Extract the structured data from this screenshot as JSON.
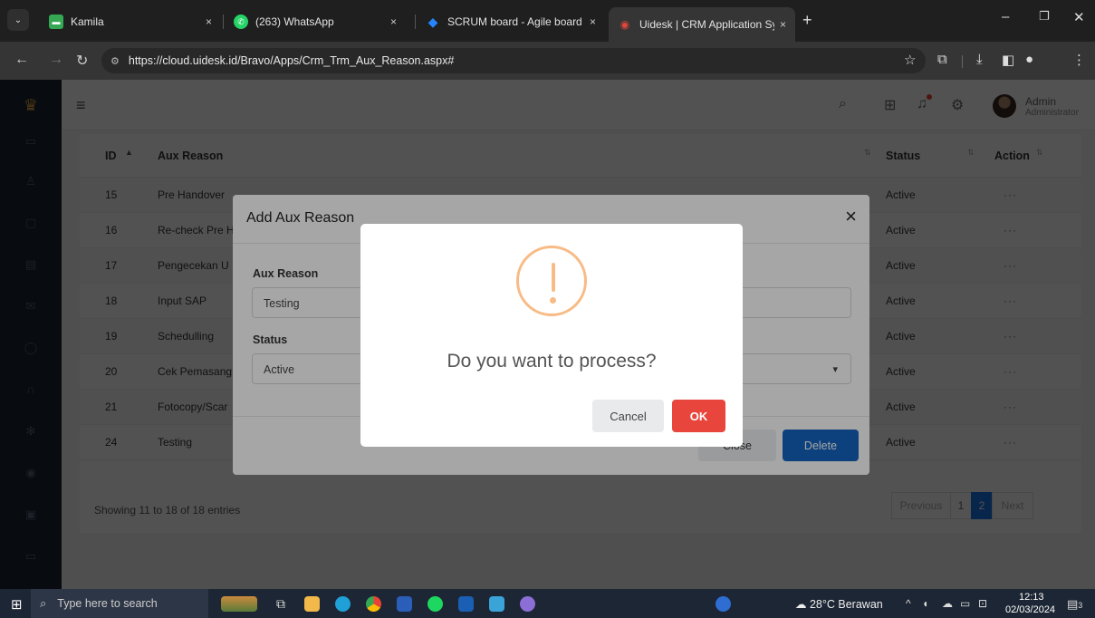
{
  "browser": {
    "tabs": [
      {
        "title": "Kamila",
        "favicon_color": "#35a853"
      },
      {
        "title": "(263) WhatsApp",
        "favicon_color": "#25d366"
      },
      {
        "title": "SCRUM board - Agile board - J",
        "favicon_color": "#2684ff"
      },
      {
        "title": "Uidesk | CRM Application Syste",
        "favicon_color": "#e0473b"
      }
    ],
    "tab_close": "×",
    "url": "https://cloud.uidesk.id/Bravo/Apps/Crm_Trm_Aux_Reason.aspx#"
  },
  "app": {
    "user_name": "Admin",
    "user_role": "Administrator",
    "accent": "#1a73e8",
    "table": {
      "headers": {
        "id": "ID",
        "reason": "Aux Reason",
        "status": "Status",
        "action": "Action"
      },
      "rows": [
        {
          "id": "15",
          "reason": "Pre Handover",
          "status": "Active",
          "action": "···"
        },
        {
          "id": "16",
          "reason": "Re-check Pre H",
          "status": "Active",
          "action": "···"
        },
        {
          "id": "17",
          "reason": "Pengecekan U",
          "status": "Active",
          "action": "···"
        },
        {
          "id": "18",
          "reason": "Input SAP",
          "status": "Active",
          "action": "···"
        },
        {
          "id": "19",
          "reason": "Schedulling",
          "status": "Active",
          "action": "···"
        },
        {
          "id": "20",
          "reason": "Cek Pemasang",
          "status": "Active",
          "action": "···"
        },
        {
          "id": "21",
          "reason": "Fotocopy/Scar",
          "status": "Active",
          "action": "···"
        },
        {
          "id": "24",
          "reason": "Testing",
          "status": "Active",
          "action": "···"
        }
      ]
    },
    "showing": "Showing 11 to 18 of 18 entries",
    "pagination": {
      "previous": "Previous",
      "page1": "1",
      "page2": "2",
      "next": "Next"
    }
  },
  "modal": {
    "title": "Add Aux Reason",
    "close_glyph": "×",
    "reason_label": "Aux Reason",
    "reason_value": "Testing",
    "status_label": "Status",
    "status_value": "Active",
    "close_button": "Close",
    "delete_button": "Delete"
  },
  "confirm": {
    "title": "Do you want to process?",
    "cancel": "Cancel",
    "ok": "OK",
    "icon_color": "#f8bb86",
    "ok_color": "#e8453c"
  },
  "taskbar": {
    "search_placeholder": "Type here to search",
    "weather": "28°C Berawan",
    "time": "12:13",
    "date": "02/03/2024",
    "notification_count": "3"
  }
}
